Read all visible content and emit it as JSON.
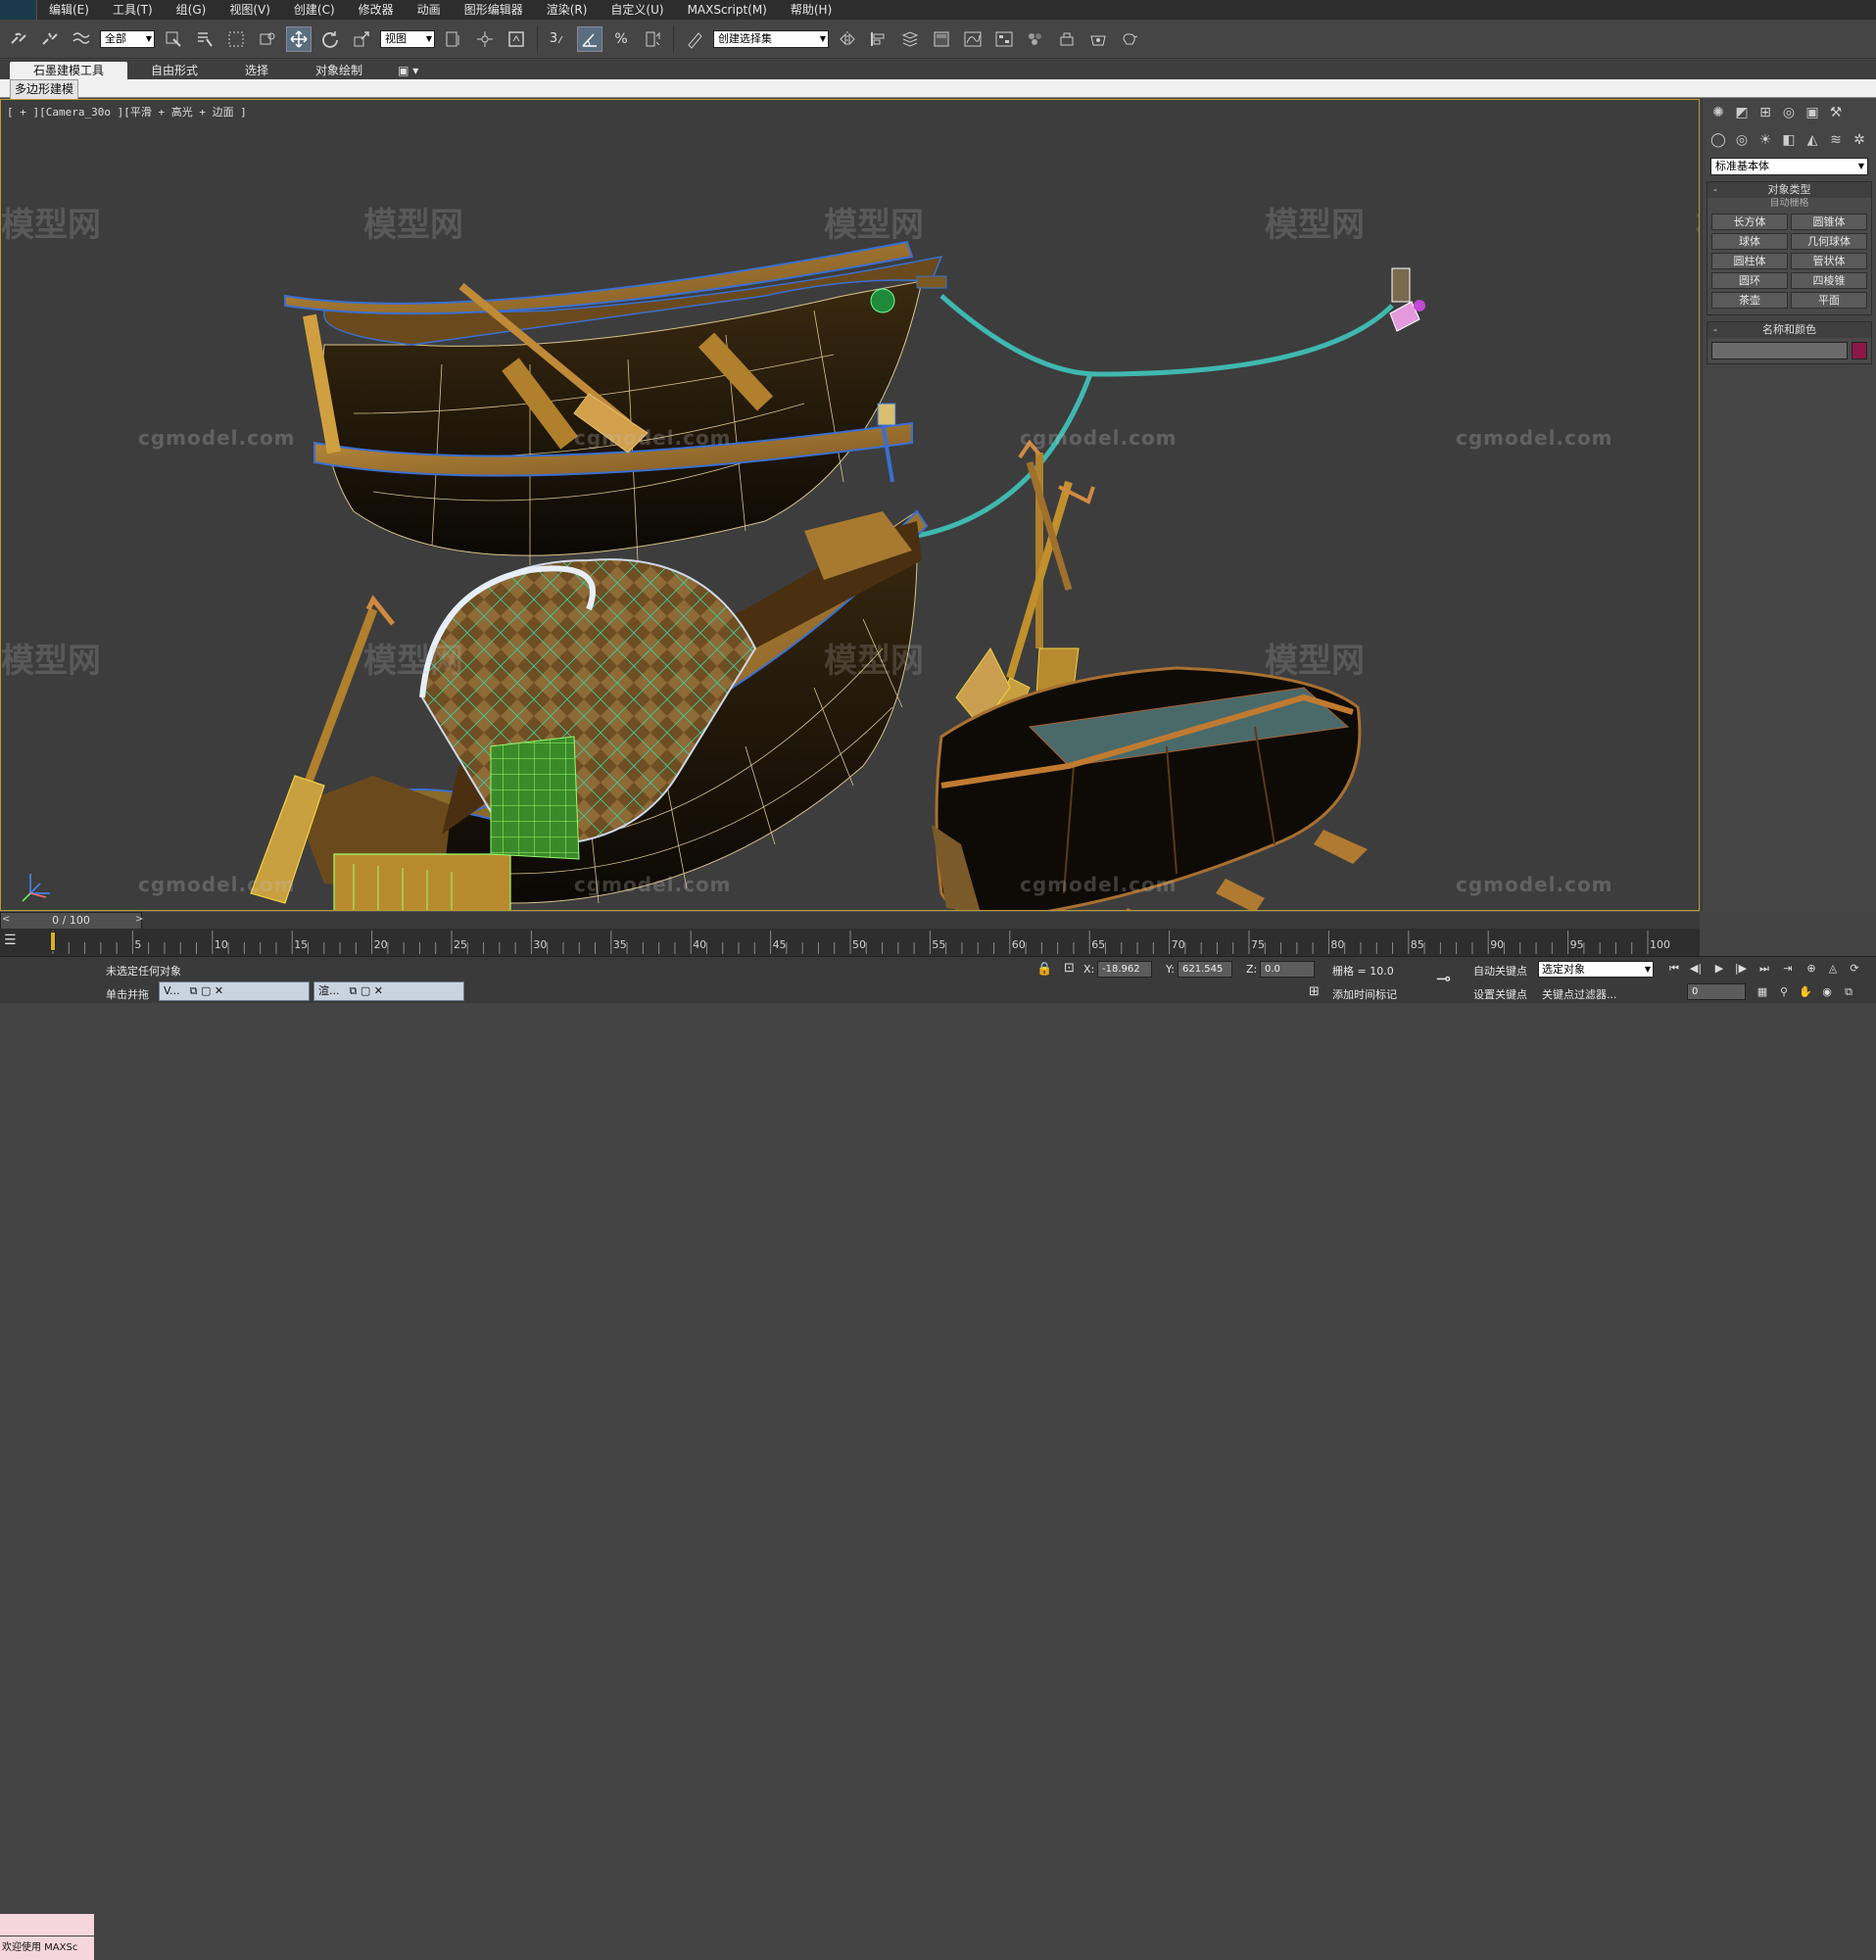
{
  "menu": {
    "items": [
      "编辑(E)",
      "工具(T)",
      "组(G)",
      "视图(V)",
      "创建(C)",
      "修改器",
      "动画",
      "图形编辑器",
      "渲染(R)",
      "自定义(U)",
      "MAXScript(M)",
      "帮助(H)"
    ]
  },
  "toolbar": {
    "selection_filter": "全部",
    "reference_coord": "视图",
    "snap_number": "3",
    "percent_snap": "%",
    "named_selection": "创建选择集"
  },
  "ribbon": {
    "tabs": [
      "石墨建模工具",
      "自由形式",
      "选择",
      "对象绘制"
    ],
    "panel_label": "多边形建模"
  },
  "viewport": {
    "label": "[ + ][Camera_30o ][平滑 + 高光 + 边面 ]",
    "watermark_en": "cgmodel.com",
    "watermark_cn": "模型网"
  },
  "command_panel": {
    "category": "标准基本体",
    "object_type_title": "对象类型",
    "autogrid": "自动栅格",
    "objects": [
      "长方体",
      "圆锥体",
      "球体",
      "几何球体",
      "圆柱体",
      "管状体",
      "圆环",
      "四棱锥",
      "茶壶",
      "平面"
    ],
    "name_color_title": "名称和颜色",
    "swatch_color": "#8b1846"
  },
  "timeline": {
    "frame_display": "0 / 100",
    "ticks": [
      "0",
      "5",
      "10",
      "15",
      "20",
      "25",
      "30",
      "35",
      "40",
      "45",
      "50",
      "55",
      "60",
      "65",
      "70",
      "75",
      "80",
      "85",
      "90",
      "95",
      "100"
    ]
  },
  "status": {
    "welcome": "欢迎使用 MAXSc",
    "selection_status": "未选定任何对象",
    "prompt": "单击并拖",
    "task1": "V...",
    "task2": "渲...",
    "x_label": "X:",
    "x_value": "-18.962",
    "y_label": "Y:",
    "y_value": "621.545",
    "z_label": "Z:",
    "z_value": "0.0",
    "grid": "栅格 = 10.0",
    "add_time_tag": "添加时间标记",
    "auto_key": "自动关键点",
    "selected_object": "选定对象",
    "set_key": "设置关键点",
    "key_filters": "关键点过滤器...",
    "frame": "0"
  }
}
